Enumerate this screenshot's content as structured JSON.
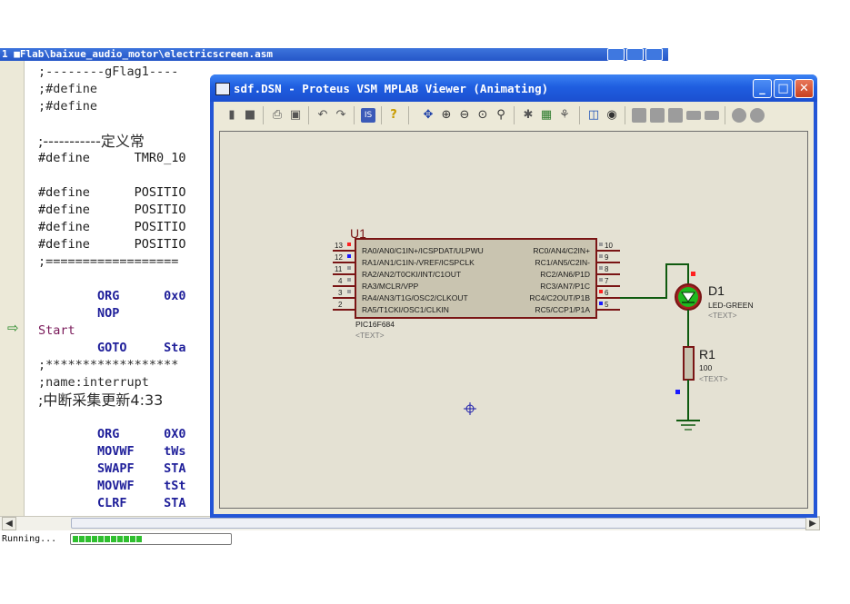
{
  "editor": {
    "title": "1 ■Flab\\baixue_audio_motor\\electricscreen.asm",
    "lines": [
      ";--------gFlag1----",
      ";#define",
      ";#define",
      "",
      ";-----------定义常",
      "#define      TMR0_10",
      "",
      "#define      POSITIO",
      "#define      POSITIO",
      "#define      POSITIO",
      "#define      POSITIO",
      ";==================",
      "",
      "        ORG      0x0",
      "        NOP",
      "Start",
      "        GOTO     Sta",
      ";******************",
      ";name:interrupt",
      ";中断采集更新4:33",
      "",
      "        ORG      0X0",
      "        MOVWF    tWs",
      "        SWAPF    STA",
      "        MOVWF    tSt",
      "        CLRF     STA"
    ],
    "exec_arrow": "⇨",
    "status_text": "Running...",
    "progress": 0.44
  },
  "proteus": {
    "title": "sdf.DSN - Proteus VSM MPLAB Viewer (Animating)",
    "icons": [
      "open-icon",
      "save-icon",
      "print-icon",
      "print-preview-icon",
      "undo-icon",
      "redo-icon",
      "isis-icon",
      "help-icon",
      "pan-icon",
      "zoom-in-icon",
      "zoom-out-icon",
      "zoom-all-icon",
      "zoom-area-icon",
      "debug-icon",
      "netlist-icon",
      "compile-icon",
      "graph-icon",
      "watch-icon",
      "step-icon",
      "pause-icon",
      "stop-icon",
      "record-icon",
      "settings-icon"
    ]
  },
  "schematic": {
    "u1": {
      "ref": "U1",
      "part": "PIC16F684",
      "text_tag": "<TEXT>",
      "left_pins": [
        {
          "num": "13",
          "name": "RA0/AN0/C1IN+/ICSPDAT/ULPWU",
          "state": "high"
        },
        {
          "num": "12",
          "name": "RA1/AN1/C1IN-/VREF/ICSPCLK",
          "state": "low"
        },
        {
          "num": "11",
          "name": "RA2/AN2/T0CKI/INT/C1OUT",
          "state": "none"
        },
        {
          "num": "4",
          "name": "RA3/MCLR/VPP",
          "state": "none"
        },
        {
          "num": "3",
          "name": "RA4/AN3/T1G/OSC2/CLKOUT",
          "state": "none"
        },
        {
          "num": "2",
          "name": "RA5/T1CKI/OSC1/CLKIN",
          "state": "none"
        }
      ],
      "right_pins": [
        {
          "num": "10",
          "name": "RC0/AN4/C2IN+",
          "state": "none"
        },
        {
          "num": "9",
          "name": "RC1/AN5/C2IN-",
          "state": "none"
        },
        {
          "num": "8",
          "name": "RC2/AN6/P1D",
          "state": "none"
        },
        {
          "num": "7",
          "name": "RC3/AN7/P1C",
          "state": "none"
        },
        {
          "num": "6",
          "name": "RC4/C2OUT/P1B",
          "state": "high"
        },
        {
          "num": "5",
          "name": "RC5/CCP1/P1A",
          "state": "low"
        }
      ]
    },
    "d1": {
      "ref": "D1",
      "value": "LED-GREEN",
      "text_tag": "<TEXT>"
    },
    "r1": {
      "ref": "R1",
      "value": "100",
      "text_tag": "<TEXT>"
    },
    "colors": {
      "body": "#c9c4b0",
      "outline": "#7a1515",
      "wire": "#0f5a0f",
      "high": "#ff2020",
      "low": "#1a1aff",
      "led": "#1fb81f"
    }
  }
}
